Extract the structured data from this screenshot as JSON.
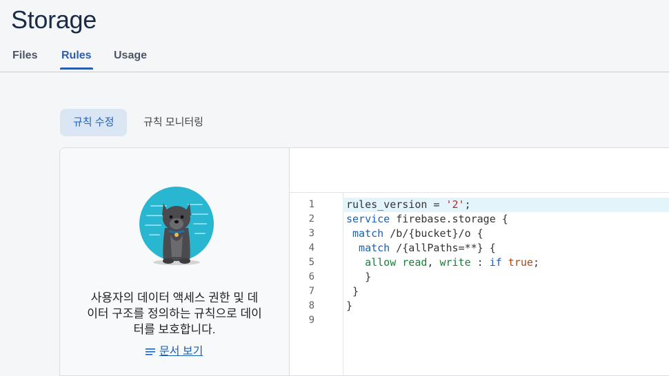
{
  "header": {
    "title": "Storage"
  },
  "tabs": [
    {
      "label": "Files"
    },
    {
      "label": "Rules"
    },
    {
      "label": "Usage"
    }
  ],
  "subtabs": [
    {
      "label": "규칙 수정"
    },
    {
      "label": "규칙 모니터링"
    }
  ],
  "info": {
    "line1": "사용자의 데이터 액세스 권한 및 데",
    "line2": "이터 구조를 정의하는 규칙으로 데이",
    "line3": "터를 보호합니다.",
    "docs_link": "문서 보기"
  },
  "editor": {
    "line_numbers": [
      "1",
      "2",
      "3",
      "4",
      "5",
      "6",
      "7",
      "8",
      "9"
    ],
    "code": {
      "l1_a": "rules_version = ",
      "l1_b": "'2'",
      "l1_c": ";",
      "l2_a": "service",
      "l2_b": " firebase.storage {",
      "l3_a": " match",
      "l3_b": " /b/{bucket}/o {",
      "l4_a": "  match",
      "l4_b": " /{allPaths=**} {",
      "l5_a": "   allow",
      "l5_b": " read",
      "l5_c": ", ",
      "l5_d": "write",
      "l5_e": " : ",
      "l5_f": "if",
      "l5_g": " true",
      "l5_h": ";",
      "l6": "   }",
      "l7": " }",
      "l8": "}",
      "l9": ""
    }
  },
  "colors": {
    "accent": "#2a5db0",
    "dog_circle": "#29b6d0"
  }
}
